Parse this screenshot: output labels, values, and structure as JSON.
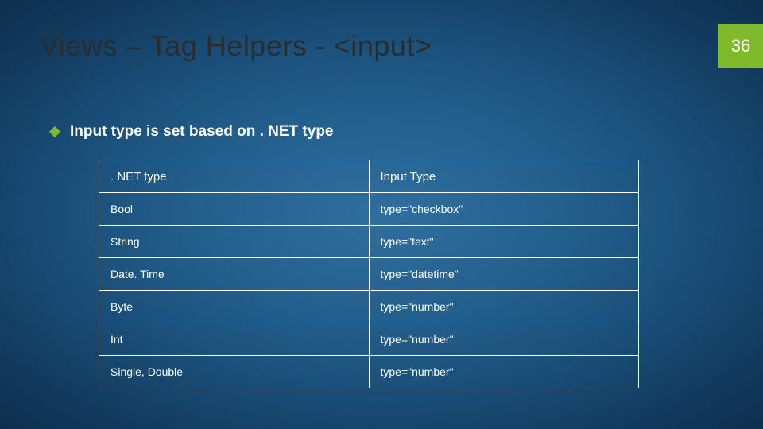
{
  "slide": {
    "title": "Views – Tag Helpers - <input>",
    "page_number": "36",
    "bullet": "Input type is set based on . NET type",
    "table": {
      "header": {
        "left": ". NET type",
        "right": "Input Type"
      },
      "rows": [
        {
          "left": "Bool",
          "right": "type=\"checkbox\""
        },
        {
          "left": "String",
          "right": "type=\"text\""
        },
        {
          "left": "Date. Time",
          "right": "type=\"datetime\""
        },
        {
          "left": "Byte",
          "right": "type=\"number\""
        },
        {
          "left": "Int",
          "right": "type=\"number\""
        },
        {
          "left": "Single, Double",
          "right": "type=\"number\""
        }
      ]
    }
  }
}
